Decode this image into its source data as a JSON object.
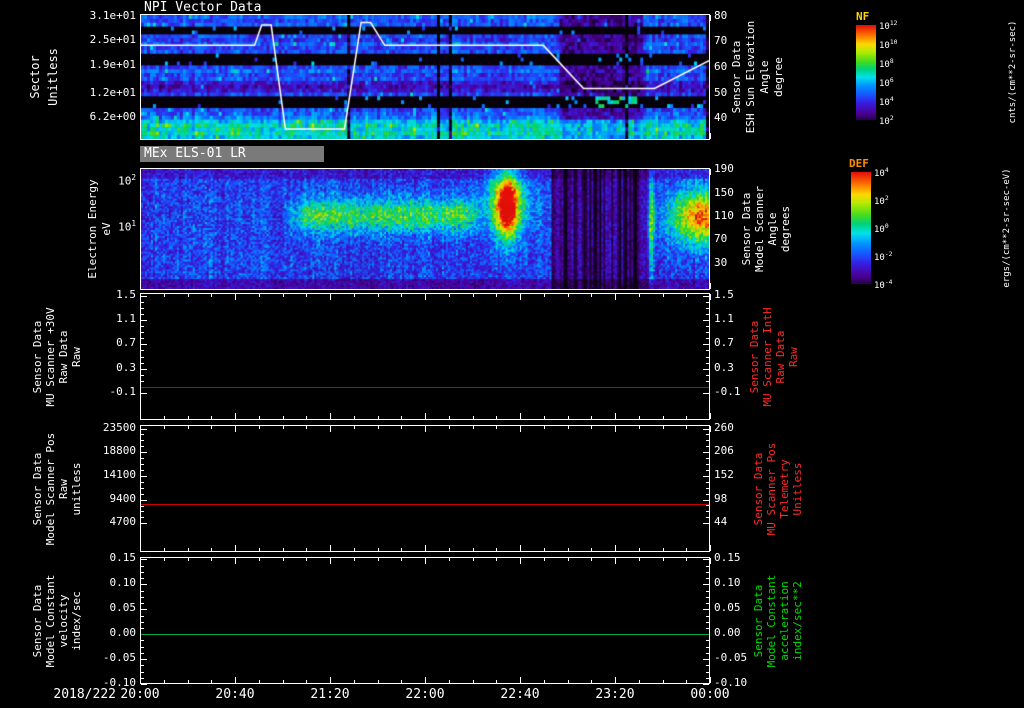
{
  "figure": {
    "bg": "#000000",
    "date_label": "2018/222",
    "x_ticks": [
      "20:00",
      "20:40",
      "21:20",
      "22:00",
      "22:40",
      "23:20",
      "00:00"
    ],
    "x_total_minutes": 240
  },
  "colorbars": [
    {
      "id": "nf",
      "title": "NF",
      "title_color": "#ffd400",
      "units": "cnts/(cm**2-sr-sec)",
      "ticks": [
        {
          "base": "10",
          "exp": "12"
        },
        {
          "base": "10",
          "exp": "10"
        },
        {
          "base": "10",
          "exp": "8"
        },
        {
          "base": "10",
          "exp": "6"
        },
        {
          "base": "10",
          "exp": "4"
        },
        {
          "base": "10",
          "exp": "2"
        }
      ]
    },
    {
      "id": "def",
      "title": "DEF",
      "title_color": "#ff8c00",
      "units": "ergs/(cm**2-sr-sec-eV)",
      "ticks": [
        {
          "base": "10",
          "exp": "4"
        },
        {
          "base": "10",
          "exp": "2"
        },
        {
          "base": "10",
          "exp": "0"
        },
        {
          "base": "10",
          "exp": "-2"
        },
        {
          "base": "10",
          "exp": "-4"
        }
      ]
    }
  ],
  "chart_data": [
    {
      "id": "npi-sector",
      "type": "heatmap",
      "title": "NPI Vector Data",
      "x_range": [
        "20:00",
        "00:00"
      ],
      "left_label_lines": [
        "Sector",
        "Unitless"
      ],
      "left_ticks": [
        {
          "v": 31,
          "label": "3.1e+01"
        },
        {
          "v": 25,
          "label": "2.5e+01"
        },
        {
          "v": 19,
          "label": "1.9e+01"
        },
        {
          "v": 12,
          "label": "1.2e+01"
        },
        {
          "v": 6.2,
          "label": "6.2e+00"
        }
      ],
      "left_range": [
        0.8,
        31.7
      ],
      "right_label_lines": [
        "Sensor Data",
        "ESH Sun Elevation",
        "Angle",
        "degree"
      ],
      "right_ticks": [
        80,
        70,
        60,
        50,
        40
      ],
      "right_range": [
        32,
        81
      ],
      "rows": 32,
      "row_profile": [
        0.34,
        0.3,
        0.32,
        0.04,
        0.04,
        0.3,
        0.27,
        0.33,
        0.29,
        0.31,
        0.05,
        0.04,
        0.05,
        0.3,
        0.34,
        0.29,
        0.31,
        0.22,
        0.18,
        0.21,
        0.29,
        0.05,
        0.04,
        0.05,
        0.31,
        0.33,
        0.36,
        0.46,
        0.52,
        0.5,
        0.53,
        0.47
      ],
      "dark_columns": [
        [
          0.737,
          0.886,
          0.5
        ]
      ],
      "patch": {
        "row0": 21,
        "row1": 23,
        "x0": 0.8,
        "x1": 0.88
      },
      "noise": 0.08,
      "seed": 11,
      "overlay_line": {
        "color": "#ffffff",
        "axis": "right",
        "points_min_deg": [
          [
            0,
            69
          ],
          [
            48,
            69
          ],
          [
            51,
            77
          ],
          [
            55,
            77
          ],
          [
            61,
            36
          ],
          [
            86,
            36
          ],
          [
            93,
            78
          ],
          [
            97,
            78
          ],
          [
            103,
            69
          ],
          [
            170,
            69
          ],
          [
            187,
            52
          ],
          [
            217,
            52
          ],
          [
            240,
            63
          ]
        ]
      }
    },
    {
      "id": "els-energy",
      "type": "heatmap",
      "title": "MEx ELS-01 LR",
      "x_range": [
        "20:00",
        "00:00"
      ],
      "left_label_lines": [
        "Electron Energy",
        "eV"
      ],
      "left_ticks_log": [
        {
          "base": "10",
          "exp": "2",
          "frac": 0.115
        },
        {
          "base": "10",
          "exp": "1",
          "frac": 0.49
        }
      ],
      "right_label_lines": [
        "Sensor Data",
        "Model Scanner",
        "Angle",
        "degrees"
      ],
      "right_ticks": [
        190,
        150,
        110,
        70,
        30
      ],
      "right_range": [
        -15,
        194
      ],
      "base_level": 0.3,
      "noise": 0.11,
      "seed": 29,
      "features": {
        "band": {
          "x0": 0.25,
          "x1": 0.61,
          "yc": 0.385,
          "ry": 0.14,
          "amp": 0.33
        },
        "burst": {
          "xc": 0.645,
          "rx": 0.02,
          "yc": 0.3,
          "ry": 0.26,
          "amp": 0.72,
          "halo_rx": 0.05,
          "halo_amp": 0.25
        },
        "dark": {
          "x0": 0.725,
          "x1": 0.895,
          "mult": 0.35
        },
        "thin_line": {
          "xc": 0.9,
          "rx": 0.006,
          "amp": 0.35
        },
        "edge_blob": {
          "xc": 0.99,
          "rx": 0.055,
          "yc": 0.4,
          "ry": 0.22,
          "amp": 0.62
        }
      }
    },
    {
      "id": "mu-scanner-30v",
      "type": "line",
      "x_range": [
        "20:00",
        "00:00"
      ],
      "left_label_lines": [
        "Sensor Data",
        "MU Scanner +30V",
        "Raw Data",
        "Raw"
      ],
      "left_ticks": [
        {
          "v": 1.5,
          "label": "1.5"
        },
        {
          "v": 1.1,
          "label": "1.1"
        },
        {
          "v": 0.7,
          "label": "0.7"
        },
        {
          "v": 0.3,
          "label": "0.3"
        },
        {
          "v": -0.1,
          "label": "-0.1"
        }
      ],
      "range": [
        -0.55,
        1.55
      ],
      "right_ticks": [
        {
          "v": 1.5,
          "label": "1.5"
        },
        {
          "v": 1.1,
          "label": "1.1"
        },
        {
          "v": 0.7,
          "label": "0.7"
        },
        {
          "v": 0.3,
          "label": "0.3"
        },
        {
          "v": -0.1,
          "label": "-0.1"
        }
      ],
      "right_range": [
        -0.55,
        1.55
      ],
      "right_label_lines": [
        "Sensor Data",
        "MU Scanner IntH",
        "Raw Data",
        "Raw"
      ],
      "right_label_color": "#ff2a2a",
      "line_value": 0.0,
      "line_color": "#cc0000"
    },
    {
      "id": "model-scanner-pos",
      "type": "line",
      "x_range": [
        "20:00",
        "00:00"
      ],
      "left_label_lines": [
        "Sensor Data",
        "Model Scanner Pos",
        "Raw",
        "unitless"
      ],
      "left_ticks": [
        {
          "v": 23500,
          "label": "23500"
        },
        {
          "v": 18800,
          "label": "18800"
        },
        {
          "v": 14100,
          "label": "14100"
        },
        {
          "v": 9400,
          "label": "9400"
        },
        {
          "v": 4700,
          "label": "4700"
        }
      ],
      "range": [
        -1000,
        24200
      ],
      "right_ticks": [
        {
          "v": 260,
          "label": "260"
        },
        {
          "v": 206,
          "label": "206"
        },
        {
          "v": 152,
          "label": "152"
        },
        {
          "v": 98,
          "label": "98"
        },
        {
          "v": 44,
          "label": "44"
        }
      ],
      "right_range": [
        -21.5,
        268
      ],
      "right_label_lines": [
        "Sensor Data",
        "MU Scanner Pos",
        "Telemetry",
        "Unitless"
      ],
      "right_label_color": "#ff2a2a",
      "line_value": 8500,
      "line_color": "#cc0000"
    },
    {
      "id": "model-constant-velocity",
      "type": "line",
      "x_range": [
        "20:00",
        "00:00"
      ],
      "left_label_lines": [
        "Sensor Data",
        "Model Constant",
        "velocity",
        "index/sec"
      ],
      "left_ticks": [
        {
          "v": 0.15,
          "label": "0.15"
        },
        {
          "v": 0.1,
          "label": "0.10"
        },
        {
          "v": 0.05,
          "label": "0.05"
        },
        {
          "v": 0.0,
          "label": "0.00"
        },
        {
          "v": -0.05,
          "label": "-0.05"
        },
        {
          "v": -0.1,
          "label": "-0.10"
        }
      ],
      "range": [
        -0.1,
        0.155
      ],
      "right_ticks": [
        {
          "v": 0.15,
          "label": "0.15"
        },
        {
          "v": 0.1,
          "label": "0.10"
        },
        {
          "v": 0.05,
          "label": "0.05"
        },
        {
          "v": 0.0,
          "label": "0.00"
        },
        {
          "v": -0.05,
          "label": "-0.05"
        },
        {
          "v": -0.1,
          "label": "-0.10"
        }
      ],
      "right_range": [
        -0.1,
        0.155
      ],
      "right_label_lines": [
        "Sensor Data",
        "Model Constant",
        "acceleration",
        "index/sec**2"
      ],
      "right_label_color": "#00dd00",
      "line_value": 0.0,
      "line_color": "#00a843"
    }
  ]
}
